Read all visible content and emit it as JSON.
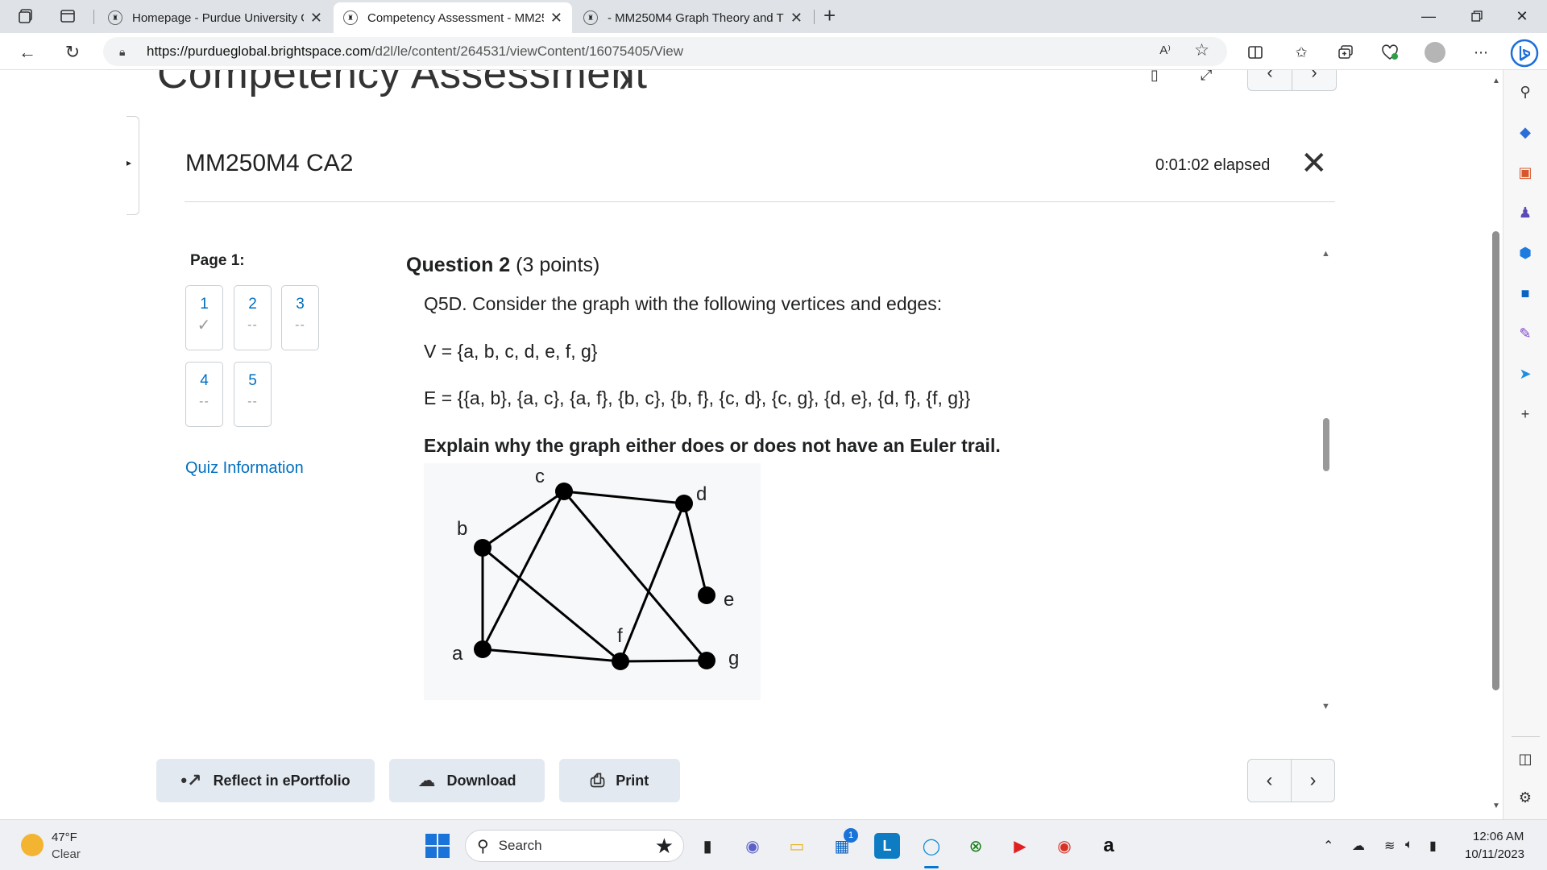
{
  "browser": {
    "tabs": [
      {
        "title": "Homepage - Purdue University G",
        "active": false
      },
      {
        "title": "Competency Assessment - MM25",
        "active": true
      },
      {
        "title": "- MM250M4 Graph Theory and T",
        "active": false
      }
    ],
    "url_domain": "https://purdueglobal.brightspace.com",
    "url_path": "/d2l/le/content/264531/viewContent/16075405/View",
    "read_aloud_label": "A⁾"
  },
  "content_header": {
    "title": "Competency Assessment"
  },
  "quiz": {
    "title": "MM250M4 CA2",
    "elapsed": "0:01:02 elapsed",
    "page_label": "Page 1:",
    "questions": [
      {
        "num": "1",
        "status": "✓"
      },
      {
        "num": "2",
        "status": "--"
      },
      {
        "num": "3",
        "status": "--"
      },
      {
        "num": "4",
        "status": "--"
      },
      {
        "num": "5",
        "status": "--"
      }
    ],
    "quiz_info_link": "Quiz Information"
  },
  "question": {
    "heading": "Question 2",
    "points": "(3 points)",
    "prompt": "Q5D. Consider the graph with the following vertices and edges:",
    "vertices": "V = {a, b, c, d, e, f, g}",
    "edges": "E = {{a, b}, {a, c}, {a, f}, {b, c}, {b, f}, {c, d}, {c, g}, {d, e}, {d, f}, {f, g}}",
    "instruction": "Explain why the graph either does or does not have an Euler trail.",
    "graph_labels": {
      "a": "a",
      "b": "b",
      "c": "c",
      "d": "d",
      "e": "e",
      "f": "f",
      "g": "g"
    }
  },
  "actions": {
    "reflect": "Reflect in ePortfolio",
    "download": "Download",
    "print": "Print"
  },
  "taskbar": {
    "temperature": "47°F",
    "condition": "Clear",
    "search_placeholder": "Search",
    "time": "12:06 AM",
    "date": "10/11/2023",
    "store_badge": "1"
  },
  "colors": {
    "link": "#006fbf",
    "action_button_bg": "#e3e9f1",
    "edge_accent": "#0078d4"
  }
}
